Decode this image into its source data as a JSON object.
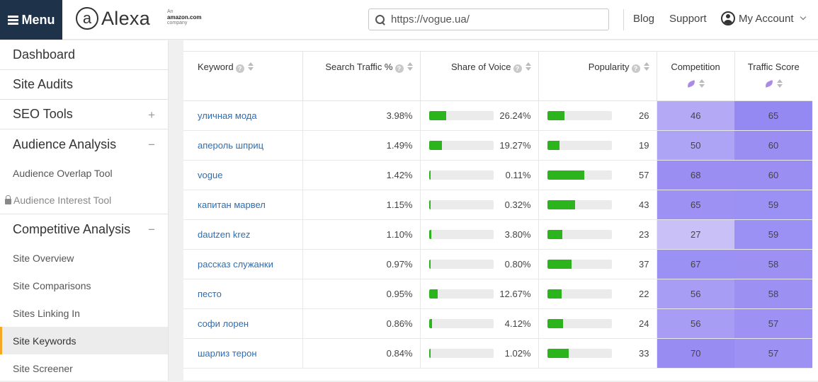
{
  "header": {
    "menu_label": "Menu",
    "logo_text": "Alexa",
    "amazon_an": "An",
    "amazon_name": "amazon.com",
    "amazon_company": "company",
    "search_value": "https://vogue.ua/",
    "blog_label": "Blog",
    "support_label": "Support",
    "account_label": "My Account"
  },
  "sidebar": {
    "dashboard": "Dashboard",
    "site_audits": "Site Audits",
    "seo_tools": "SEO Tools",
    "audience_analysis": "Audience Analysis",
    "audience_overlap": "Audience Overlap Tool",
    "audience_interest": "Audience Interest Tool",
    "competitive_analysis": "Competitive Analysis",
    "site_overview": "Site Overview",
    "site_comparisons": "Site Comparisons",
    "sites_linking_in": "Sites Linking In",
    "site_keywords": "Site Keywords",
    "site_screener": "Site Screener"
  },
  "table": {
    "headers": {
      "keyword": "Keyword",
      "search_traffic": "Search Traffic %",
      "share_of_voice": "Share of Voice",
      "popularity": "Popularity",
      "competition": "Competition",
      "traffic_score": "Traffic Score"
    },
    "rows": [
      {
        "keyword": "уличная мода",
        "traffic": "3.98%",
        "sov": "26.24%",
        "sov_pct": 26.24,
        "pop": "26",
        "comp": "46",
        "ts": "65"
      },
      {
        "keyword": "апероль шприц",
        "traffic": "1.49%",
        "sov": "19.27%",
        "sov_pct": 19.27,
        "pop": "19",
        "comp": "50",
        "ts": "60"
      },
      {
        "keyword": "vogue",
        "traffic": "1.42%",
        "sov": "0.11%",
        "sov_pct": 0.11,
        "pop": "57",
        "comp": "68",
        "ts": "60"
      },
      {
        "keyword": "капитан марвел",
        "traffic": "1.15%",
        "sov": "0.32%",
        "sov_pct": 0.32,
        "pop": "43",
        "comp": "65",
        "ts": "59"
      },
      {
        "keyword": "dautzen krez",
        "traffic": "1.10%",
        "sov": "3.80%",
        "sov_pct": 3.8,
        "pop": "23",
        "comp": "27",
        "ts": "59"
      },
      {
        "keyword": "рассказ служанки",
        "traffic": "0.97%",
        "sov": "0.80%",
        "sov_pct": 0.8,
        "pop": "37",
        "comp": "67",
        "ts": "58"
      },
      {
        "keyword": "песто",
        "traffic": "0.95%",
        "sov": "12.67%",
        "sov_pct": 12.67,
        "pop": "22",
        "comp": "56",
        "ts": "58"
      },
      {
        "keyword": "софи лорен",
        "traffic": "0.86%",
        "sov": "4.12%",
        "sov_pct": 4.12,
        "pop": "24",
        "comp": "56",
        "ts": "57"
      },
      {
        "keyword": "шарлиз терон",
        "traffic": "0.84%",
        "sov": "1.02%",
        "sov_pct": 1.02,
        "pop": "33",
        "comp": "70",
        "ts": "57"
      }
    ]
  },
  "colors": {
    "menu_bg": "#1e3249",
    "bar_fill": "#2bb41b",
    "link": "#2e6db3",
    "active_border": "#f5a623"
  }
}
